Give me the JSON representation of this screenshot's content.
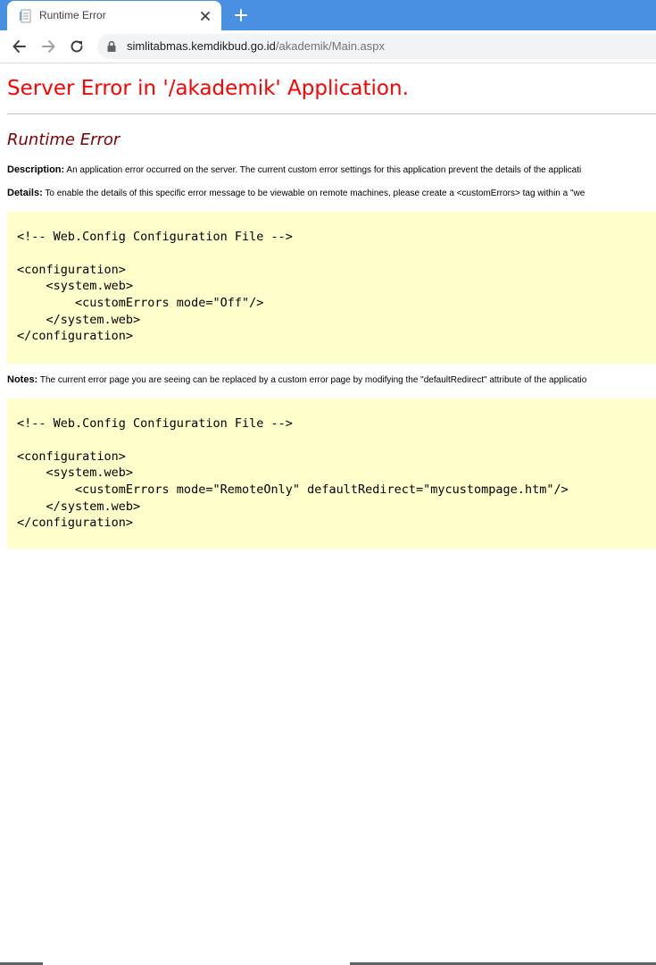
{
  "browser": {
    "tab_title": "Runtime Error",
    "url_host": "simlitabmas.kemdikbud.go.id",
    "url_path": "/akademik/Main.aspx"
  },
  "error_page": {
    "heading": "Server Error in '/akademik' Application.",
    "subheading": "Runtime Error",
    "description_label": "Description:",
    "description_text": " An application error occurred on the server. The current custom error settings for this application prevent the details of the applicati",
    "details_label": "Details:",
    "details_text": " To enable the details of this specific error message to be viewable on remote machines, please create a <customErrors> tag within a \"we",
    "code_block_1": "\n<!-- Web.Config Configuration File -->\n\n<configuration>\n    <system.web>\n        <customErrors mode=\"Off\"/>\n    </system.web>\n</configuration>",
    "notes_label": "Notes:",
    "notes_text": " The current error page you are seeing can be replaced by a custom error page by modifying the \"defaultRedirect\" attribute of the applicatio",
    "code_block_2": "\n<!-- Web.Config Configuration File -->\n\n<configuration>\n    <system.web>\n        <customErrors mode=\"RemoteOnly\" defaultRedirect=\"mycustompage.htm\"/>\n    </system.web>\n</configuration>"
  },
  "colors": {
    "tabbar": "#4a90e2",
    "heading": "#ff0000",
    "subheading": "#800000",
    "code_background": "#ffffcc"
  },
  "icons": {
    "favicon": "document-icon",
    "tab_close": "close-icon",
    "new_tab": "plus-icon",
    "back": "arrow-left-icon",
    "forward": "arrow-right-icon",
    "reload": "reload-icon",
    "security": "lock-icon"
  }
}
